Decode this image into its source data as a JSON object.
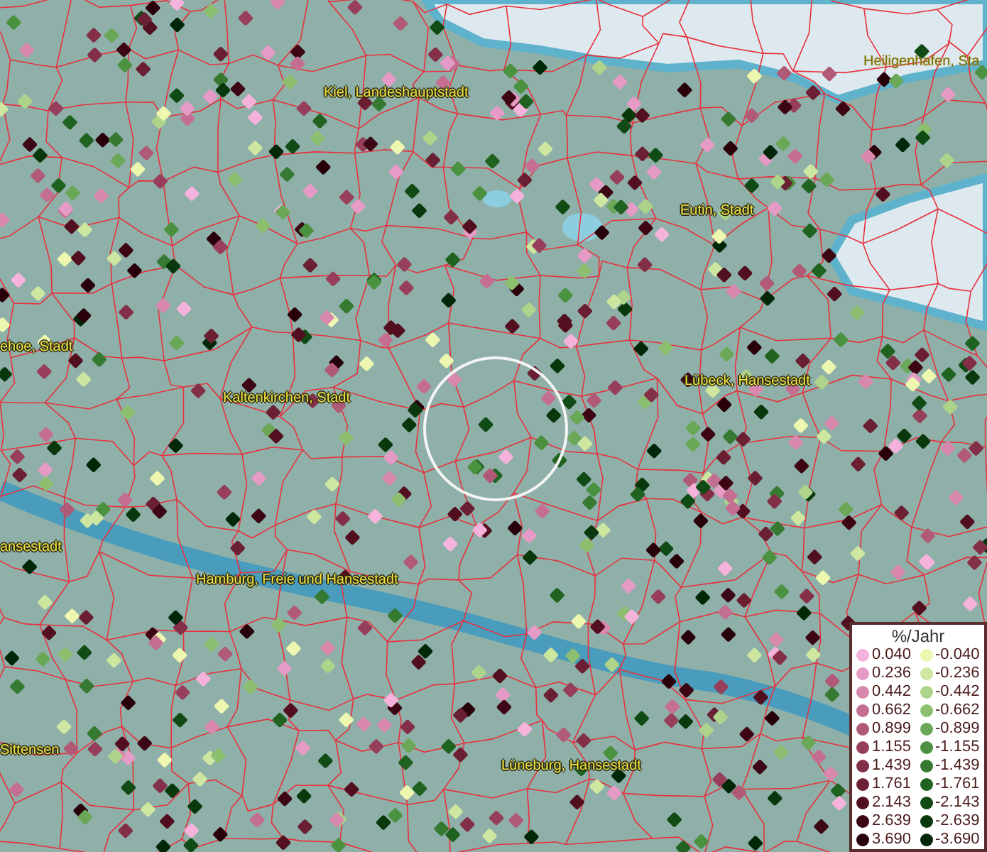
{
  "map": {
    "place_labels": [
      {
        "text": "Heiligenhafen, Sta"
      },
      {
        "text": "Kiel, Landeshauptstadt"
      },
      {
        "text": "Eutin, Stadt"
      },
      {
        "text": "ehoe, Stadt"
      },
      {
        "text": "Kaltenkirchen, Stadt"
      },
      {
        "text": "Lübeck, Hansestadt"
      },
      {
        "text": "ansestadt"
      },
      {
        "text": "Hamburg, Freie und Hansestadt"
      },
      {
        "text": "Sittensen"
      },
      {
        "text": "Lüneburg, Hansestadt"
      }
    ]
  },
  "legend": {
    "title": "%/Jahr",
    "entries": [
      {
        "label": "0.040",
        "color": "#f5b3dc"
      },
      {
        "label": "-0.040",
        "color": "#eef7b0"
      },
      {
        "label": "0.236",
        "color": "#e59bc6"
      },
      {
        "label": "-0.236",
        "color": "#cde6a0"
      },
      {
        "label": "0.442",
        "color": "#d888ad"
      },
      {
        "label": "-0.442",
        "color": "#aed38a"
      },
      {
        "label": "0.662",
        "color": "#c46f92"
      },
      {
        "label": "-0.662",
        "color": "#8cc070"
      },
      {
        "label": "0.899",
        "color": "#b05a78"
      },
      {
        "label": "-0.899",
        "color": "#6aa858"
      },
      {
        "label": "1.155",
        "color": "#973f5a"
      },
      {
        "label": "-1.155",
        "color": "#4a9240"
      },
      {
        "label": "1.439",
        "color": "#842f48"
      },
      {
        "label": "-1.439",
        "color": "#357a30"
      },
      {
        "label": "1.761",
        "color": "#6a1f32"
      },
      {
        "label": "-1.761",
        "color": "#206220"
      },
      {
        "label": "2.143",
        "color": "#520f1f"
      },
      {
        "label": "-2.143",
        "color": "#104a14"
      },
      {
        "label": "2.639",
        "color": "#3d0614"
      },
      {
        "label": "-2.639",
        "color": "#08380c"
      },
      {
        "label": "3.690",
        "color": "#28000a"
      },
      {
        "label": "-3.690",
        "color": "#002808"
      }
    ]
  }
}
